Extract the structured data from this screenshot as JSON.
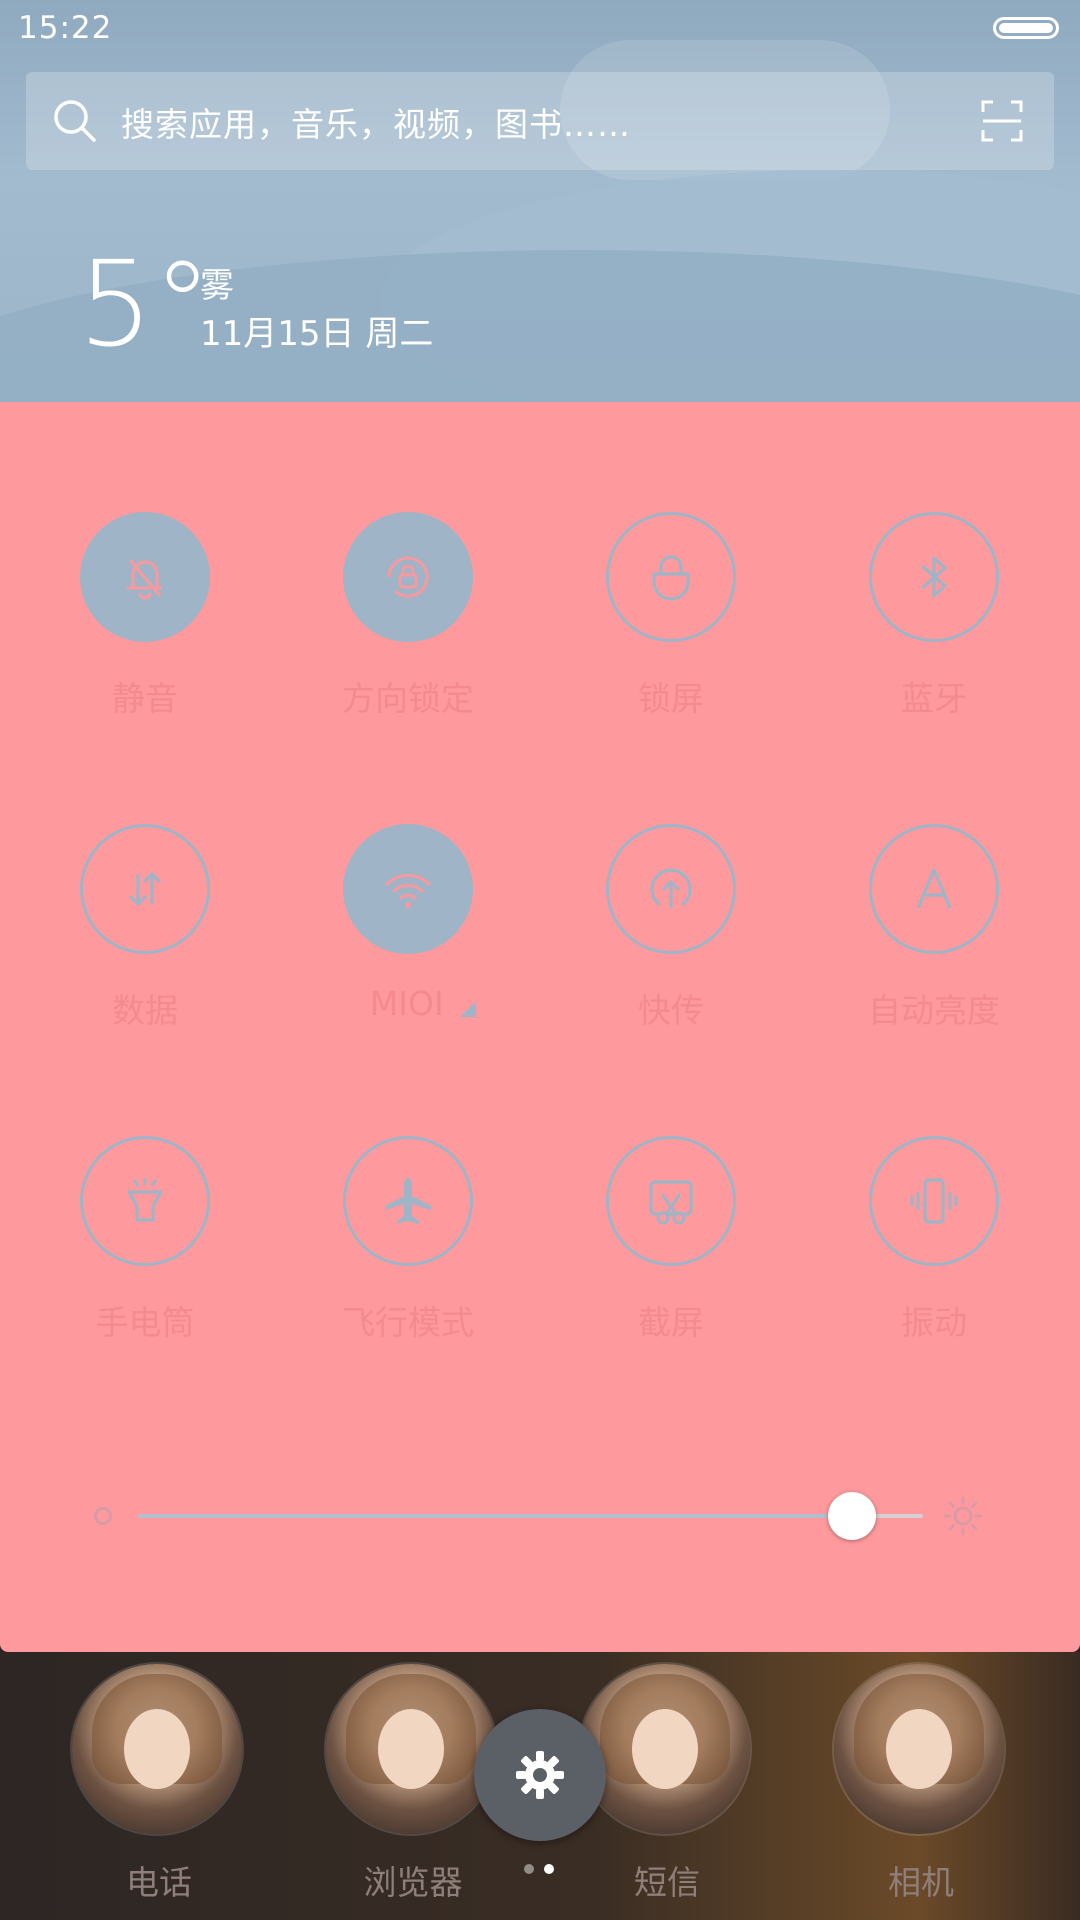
{
  "status_bar": {
    "time": "15:22"
  },
  "search": {
    "placeholder": "搜索应用，音乐，视频，图书……"
  },
  "weather": {
    "temperature": "5°",
    "condition": "雾",
    "date": "11月15日 周二"
  },
  "quick_settings": {
    "tiles": [
      {
        "label": "静音",
        "icon": "bell-off-icon",
        "active": true
      },
      {
        "label": "方向锁定",
        "icon": "rotation-lock-icon",
        "active": true
      },
      {
        "label": "锁屏",
        "icon": "lock-icon",
        "active": false
      },
      {
        "label": "蓝牙",
        "icon": "bluetooth-icon",
        "active": false
      },
      {
        "label": "数据",
        "icon": "data-arrows-icon",
        "active": false
      },
      {
        "label": "MIOI",
        "icon": "wifi-icon",
        "active": true
      },
      {
        "label": "快传",
        "icon": "upload-icon",
        "active": false
      },
      {
        "label": "自动亮度",
        "icon": "auto-brightness-icon",
        "active": false
      },
      {
        "label": "手电筒",
        "icon": "flashlight-icon",
        "active": false
      },
      {
        "label": "飞行模式",
        "icon": "airplane-icon",
        "active": false
      },
      {
        "label": "截屏",
        "icon": "screenshot-icon",
        "active": false
      },
      {
        "label": "振动",
        "icon": "vibrate-icon",
        "active": false
      }
    ],
    "brightness": {
      "level": 0.91
    }
  },
  "dock": {
    "apps": [
      {
        "label": "电话"
      },
      {
        "label": "浏览器"
      },
      {
        "label": "短信"
      },
      {
        "label": "相机"
      }
    ],
    "page_indicator": {
      "pages": 2,
      "current": 2
    }
  },
  "colors": {
    "panel": "#fe9a9d",
    "tile_on": "#9fb4c7",
    "tile_label": "#f28a90",
    "header": "#98b1c5"
  }
}
